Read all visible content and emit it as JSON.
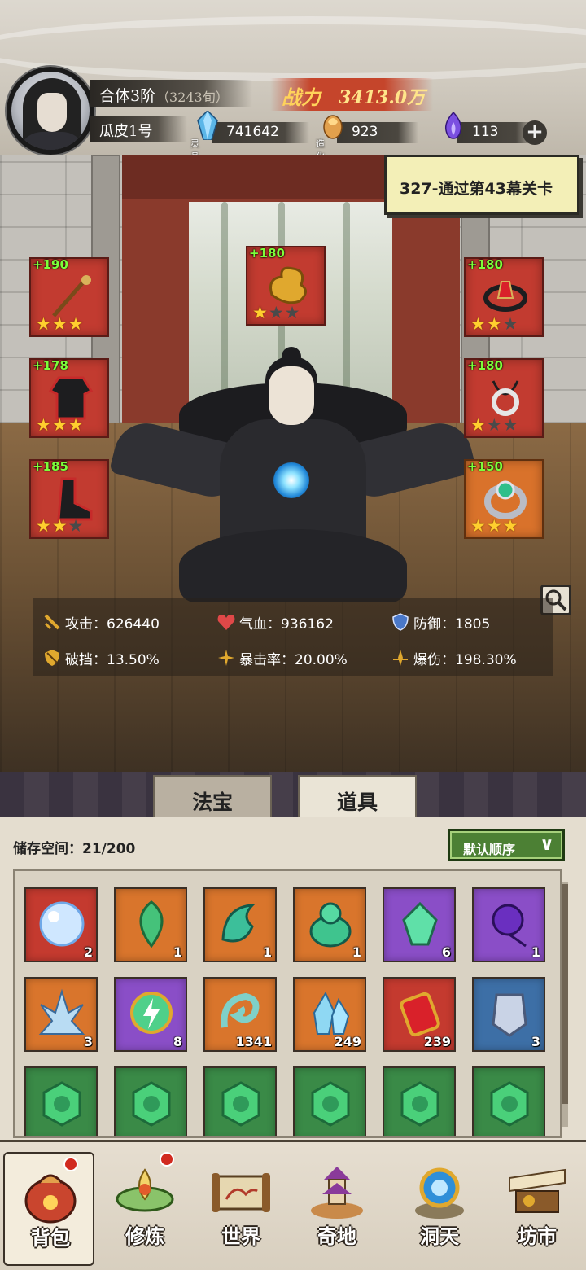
{
  "player": {
    "realm": "合体3阶",
    "realm_detail": "（3243旬）",
    "name": "瓜皮1号",
    "power_label": "战力",
    "power_value": "3413.0万"
  },
  "resources": [
    {
      "name": "灵晶",
      "value": "741642",
      "icon": "crystal-icon",
      "color": "#5bb6e8"
    },
    {
      "name": "造化石",
      "value": "923",
      "icon": "stone-icon",
      "color": "#e2a04c"
    },
    {
      "name": "",
      "value": "113",
      "icon": "purple-flame-icon",
      "color": "#7b4fe0"
    }
  ],
  "quest": {
    "label": "327-通过第43幕关卡"
  },
  "equipment": {
    "left": [
      {
        "level": "+190",
        "stars": 3,
        "icon": "staff-icon"
      },
      {
        "level": "+178",
        "stars": 3,
        "icon": "robe-icon"
      },
      {
        "level": "+185",
        "stars": 2,
        "icon": "boots-icon"
      }
    ],
    "center": {
      "level": "+180",
      "stars": 1,
      "icon": "cloud-ornament-icon"
    },
    "right": [
      {
        "level": "+180",
        "stars": 2,
        "icon": "headband-icon"
      },
      {
        "level": "+180",
        "stars": 1,
        "icon": "necklace-icon"
      },
      {
        "level": "+150",
        "stars": 3,
        "icon": "ring-icon"
      }
    ]
  },
  "stats": [
    {
      "label": "攻击：626440",
      "icon": "sword-icon"
    },
    {
      "label": "气血：936162",
      "icon": "heart-icon"
    },
    {
      "label": "防御：1805",
      "icon": "shield-icon"
    },
    {
      "label": "破挡：13.50%",
      "icon": "break-icon"
    },
    {
      "label": "暴击率：20.00%",
      "icon": "crit-icon"
    },
    {
      "label": "爆伤：198.30%",
      "icon": "crit-damage-icon"
    }
  ],
  "tabs": [
    {
      "label": "法宝"
    },
    {
      "label": "道具"
    }
  ],
  "inventory": {
    "storage_label": "储存空间：21/200",
    "sort_label": "默认顺序",
    "items": [
      {
        "count": "2",
        "rarity": "red",
        "icon": "pearl-icon"
      },
      {
        "count": "1",
        "rarity": "orange",
        "icon": "leaf-jade-icon"
      },
      {
        "count": "1",
        "rarity": "orange",
        "icon": "wave-jade-icon"
      },
      {
        "count": "1",
        "rarity": "orange",
        "icon": "lotus-jade-icon"
      },
      {
        "count": "6",
        "rarity": "purple",
        "icon": "green-crystal-icon"
      },
      {
        "count": "1",
        "rarity": "purple",
        "icon": "purple-flower-icon"
      },
      {
        "count": "3",
        "rarity": "orange",
        "icon": "ice-crystal-icon"
      },
      {
        "count": "8",
        "rarity": "purple",
        "icon": "lightning-orb-icon"
      },
      {
        "count": "1341",
        "rarity": "orange",
        "icon": "swirl-jade-icon"
      },
      {
        "count": "249",
        "rarity": "orange",
        "icon": "crystal-cluster-icon"
      },
      {
        "count": "239",
        "rarity": "red",
        "icon": "talisman-icon"
      },
      {
        "count": "3",
        "rarity": "blue",
        "icon": "silver-badge-icon"
      },
      {
        "count": "",
        "rarity": "green",
        "icon": "green-token-icon"
      },
      {
        "count": "",
        "rarity": "green",
        "icon": "green-token-icon"
      },
      {
        "count": "",
        "rarity": "green",
        "icon": "green-token-icon"
      },
      {
        "count": "",
        "rarity": "green",
        "icon": "green-token-icon"
      },
      {
        "count": "",
        "rarity": "green",
        "icon": "green-token-icon"
      },
      {
        "count": "",
        "rarity": "green",
        "icon": "green-token-icon"
      }
    ]
  },
  "nav": [
    {
      "label": "背包",
      "icon": "bag-icon",
      "badge": true,
      "active": true
    },
    {
      "label": "修炼",
      "icon": "lotus-icon",
      "badge": true,
      "active": false
    },
    {
      "label": "世界",
      "icon": "scroll-map-icon",
      "badge": false,
      "active": false
    },
    {
      "label": "奇地",
      "icon": "pagoda-icon",
      "badge": false,
      "active": false
    },
    {
      "label": "洞天",
      "icon": "portal-icon",
      "badge": false,
      "active": false
    },
    {
      "label": "坊市",
      "icon": "market-stall-icon",
      "badge": false,
      "active": false
    }
  ]
}
